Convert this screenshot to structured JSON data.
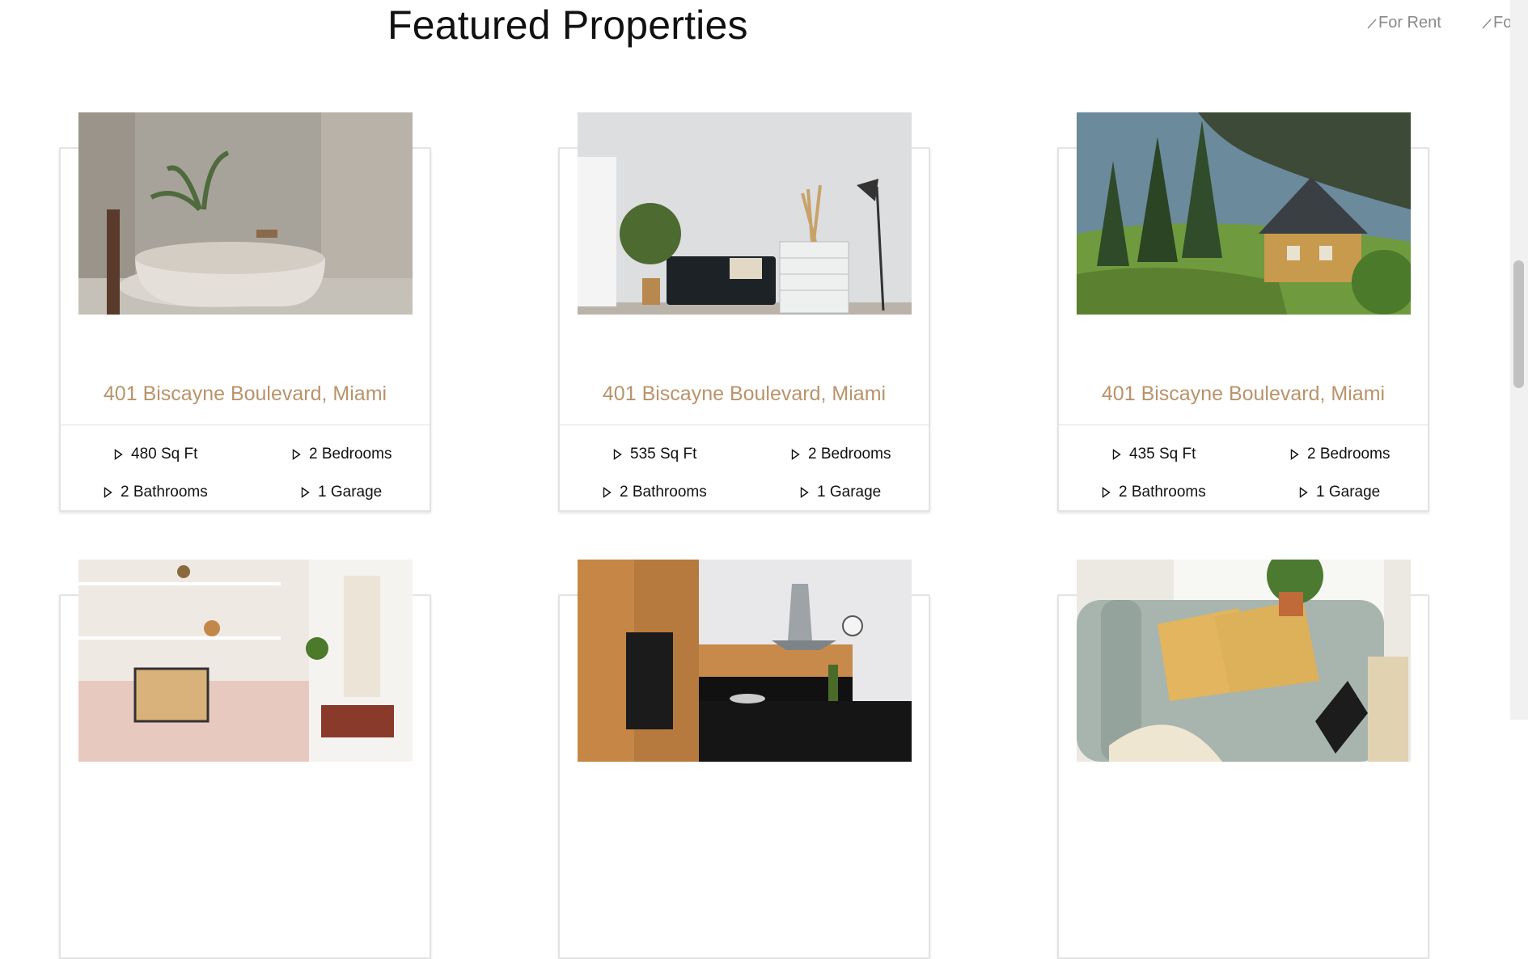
{
  "section": {
    "title": "Featured Properties",
    "filters": [
      {
        "label": "For Rent",
        "icon": "slash-icon"
      },
      {
        "label": "For Sale",
        "icon": "slash-icon"
      }
    ]
  },
  "colors": {
    "address": "#b9936a",
    "filter": "#8a8a8a",
    "card_border": "#e3e3e3"
  },
  "properties": [
    {
      "address": "401 Biscayne Boulevard, Miami",
      "area": "480 Sq Ft",
      "bedrooms": "2 Bedrooms",
      "bathrooms": "2 Bathrooms",
      "garage": "1 Garage",
      "photo": "bathroom-with-freestanding-tub"
    },
    {
      "address": "401 Biscayne Boulevard, Miami",
      "area": "535 Sq Ft",
      "bedrooms": "2 Bedrooms",
      "bathrooms": "2 Bathrooms",
      "garage": "1 Garage",
      "photo": "living-room-with-sofa-and-dresser"
    },
    {
      "address": "401 Biscayne Boulevard, Miami",
      "area": "435 Sq Ft",
      "bedrooms": "2 Bedrooms",
      "bathrooms": "2 Bathrooms",
      "garage": "1 Garage",
      "photo": "coastal-house-with-pine-trees"
    },
    {
      "photo": "room-with-shelves-and-decor"
    },
    {
      "photo": "modern-wooden-kitchen"
    },
    {
      "photo": "armchair-with-yellow-pillows"
    }
  ]
}
